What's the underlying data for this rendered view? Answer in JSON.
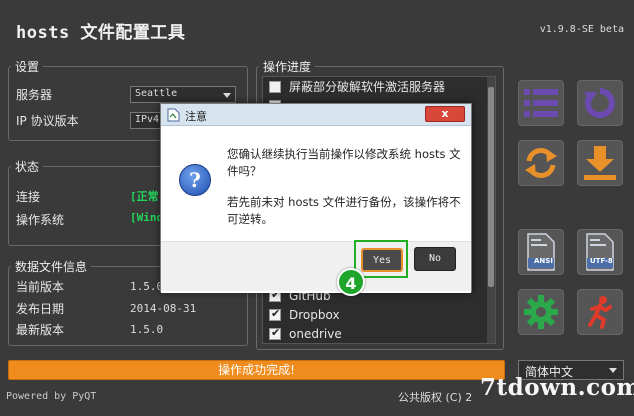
{
  "app": {
    "title": "hosts 文件配置工具",
    "version": "v1.9.8-SE beta"
  },
  "settings": {
    "legend": "设置",
    "server_label": "服务器",
    "server_value": "Seattle",
    "ip_label": "IP 协议版本",
    "ip_value": "IPv4"
  },
  "status": {
    "legend": "状态",
    "connection_label": "连接",
    "connection_value": "[正常]",
    "os_label": "操作系统",
    "os_value": "[Windows]"
  },
  "datafile": {
    "legend": "数据文件信息",
    "current_label": "当前版本",
    "current_value": "1.5.0",
    "release_label": "发布日期",
    "release_value": "2014-08-31",
    "latest_label": "最新版本",
    "latest_value": "1.5.0"
  },
  "operations": {
    "legend": "操作进度",
    "items": [
      {
        "label": "屏蔽部分破解软件激活服务器",
        "checked": false
      },
      {
        "label": "",
        "checked": false
      },
      {
        "label": "",
        "checked": false
      },
      {
        "label": "",
        "checked": false
      },
      {
        "label": "",
        "checked": false
      },
      {
        "label": "",
        "checked": false
      },
      {
        "label": "",
        "checked": false
      },
      {
        "label": "",
        "checked": false
      },
      {
        "label": "",
        "checked": false
      },
      {
        "label": "",
        "checked": false
      },
      {
        "label": "",
        "checked": false
      },
      {
        "label": "GitHub",
        "checked": true
      },
      {
        "label": "Dropbox",
        "checked": true
      },
      {
        "label": "onedrive",
        "checked": true
      }
    ]
  },
  "tiles": {
    "list": "list-icon",
    "restore": "restore-icon",
    "refresh": "refresh-icon",
    "download": "download-icon",
    "ansi_label": "ANSI",
    "utf8_label": "UTF-8",
    "settings": "gear-icon",
    "exit": "running-man-icon"
  },
  "progress": {
    "text": "操作成功完成!",
    "percent": 100
  },
  "language": {
    "value": "简体中文"
  },
  "footer": {
    "powered": "Powered by PyQT",
    "license": "公共版权 (C) 2"
  },
  "dialog": {
    "title": "注意",
    "close": "x",
    "message1": "您确认继续执行当前操作以修改系统 hosts 文件吗？",
    "message2": "若先前未对 hosts 文件进行备份，该操作将不可逆转。",
    "yes": "Yes",
    "no": "No"
  },
  "annotation": {
    "step": "4"
  },
  "watermark": "7tdown.com",
  "colors": {
    "accent_orange": "#ef8c1d",
    "tile_purple": "#6b4bb0",
    "tile_orange": "#e8902a",
    "tile_green": "#2ba84a",
    "tile_red": "#e03a2a",
    "status_green": "#22d65a",
    "highlight_green": "#22b022"
  }
}
